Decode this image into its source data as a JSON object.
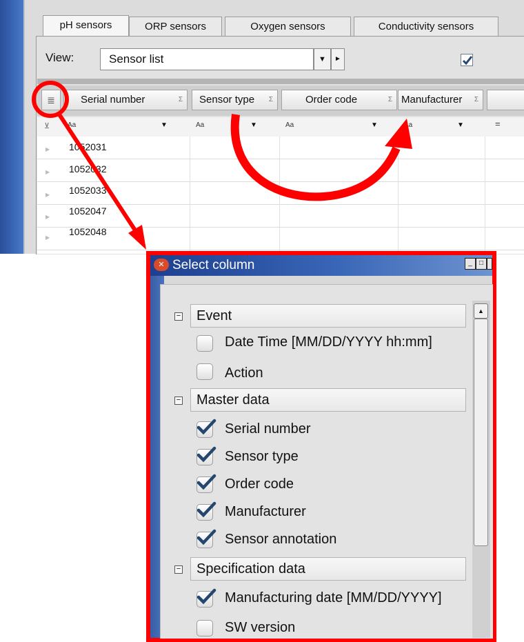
{
  "tabs": [
    {
      "label": "pH sensors",
      "active": true
    },
    {
      "label": "ORP sensors"
    },
    {
      "label": "Oxygen sensors"
    },
    {
      "label": "Conductivity sensors"
    }
  ],
  "view": {
    "label": "View:",
    "selected": "Sensor list",
    "checked": true
  },
  "columns": [
    {
      "label": "Serial number",
      "sigma": "Σ"
    },
    {
      "label": "Sensor type",
      "sigma": "Σ"
    },
    {
      "label": "Order code",
      "sigma": "Σ"
    },
    {
      "label": "Manufacturer",
      "sigma": "Σ"
    }
  ],
  "filter": {
    "aa": "Aa",
    "eq": "="
  },
  "rows": [
    "1052031",
    "1052032",
    "1052033",
    "1052047",
    "1052048"
  ],
  "dialog": {
    "title": "Select column",
    "groups": [
      {
        "label": "Event",
        "items": [
          {
            "label": "Date  Time [MM/DD/YYYY  hh:mm]",
            "checked": false
          },
          {
            "label": "Action",
            "checked": false
          }
        ]
      },
      {
        "label": "Master data",
        "items": [
          {
            "label": "Serial number",
            "checked": true
          },
          {
            "label": "Sensor type",
            "checked": true
          },
          {
            "label": "Order code",
            "checked": true
          },
          {
            "label": "Manufacturer",
            "checked": true
          },
          {
            "label": "Sensor annotation",
            "checked": true
          }
        ]
      },
      {
        "label": "Specification data",
        "items": [
          {
            "label": "Manufacturing date [MM/DD/YYYY]",
            "checked": true
          },
          {
            "label": "SW version",
            "checked": false
          }
        ]
      }
    ]
  },
  "colors": {
    "annotation": "#ff0000",
    "check": "#24466f",
    "titlebar": "#2a55a5"
  }
}
